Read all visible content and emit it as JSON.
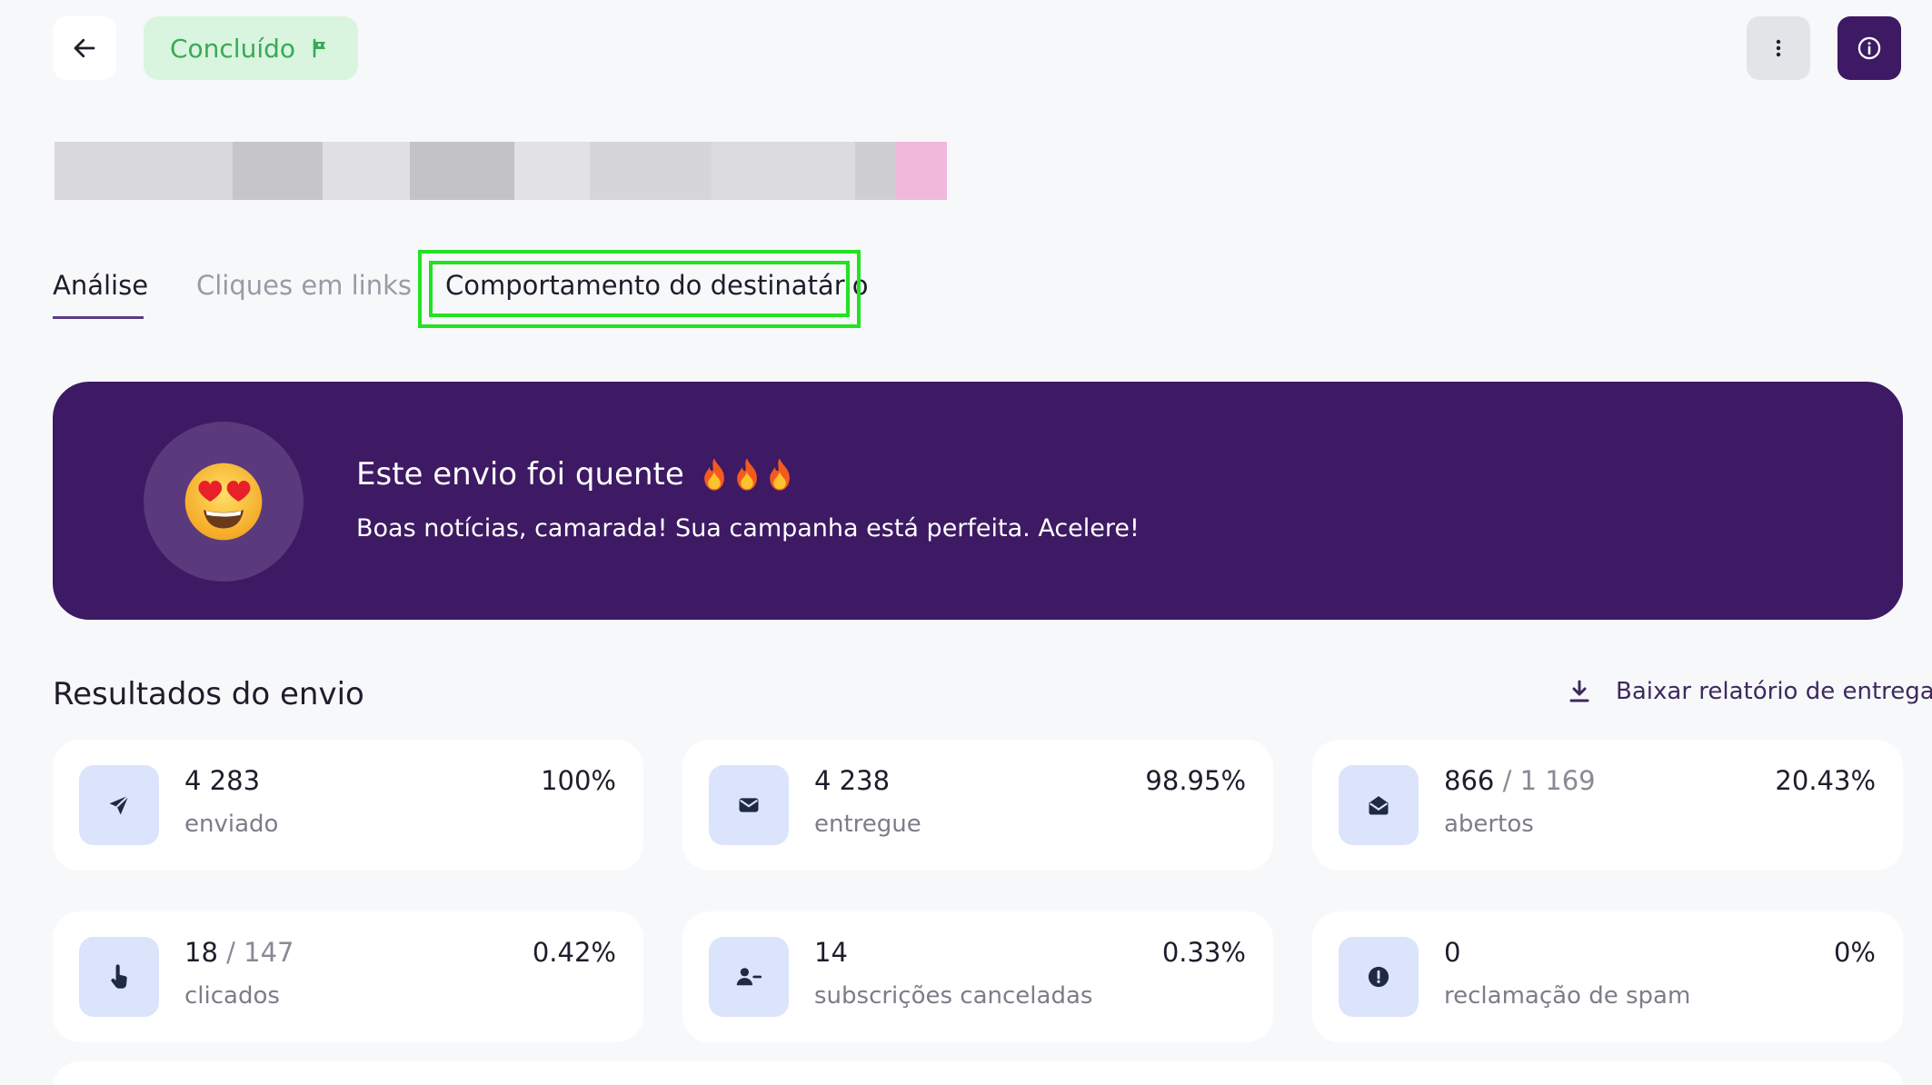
{
  "header": {
    "status_label": "Concluído",
    "icons": {
      "back": "arrow-left-icon",
      "status": "flag-icon",
      "more": "more-vertical-icon",
      "info": "info-icon"
    }
  },
  "colors": {
    "brand_purple": "#3d1a63",
    "status_green": "#3aa955",
    "status_green_bg": "#d9f5df",
    "highlight_green": "#22e222",
    "icon_bg": "#dbe4fb"
  },
  "tabs": [
    {
      "label": "Análise",
      "active": true
    },
    {
      "label": "Cliques em links",
      "active": false
    },
    {
      "label": "Comportamento do destinatário",
      "active": false,
      "highlighted": true
    }
  ],
  "banner": {
    "title": "Este envio foi quente",
    "title_icons": [
      "fire-icon",
      "fire-icon",
      "fire-icon"
    ],
    "subtitle": "Boas notícias, camarada! Sua campanha está perfeita. Acelere!",
    "emoji": "heart-eyes-emoji-icon"
  },
  "results": {
    "title": "Resultados do envio",
    "download_label": "Baixar relatório de entrega",
    "download_icon": "download-icon",
    "stats": [
      {
        "value": "4 283",
        "total": "",
        "label": "enviado",
        "percent": "100%",
        "icon": "send-icon"
      },
      {
        "value": "4 238",
        "total": "",
        "label": "entregue",
        "percent": "98.95%",
        "icon": "envelope-icon"
      },
      {
        "value": "866",
        "total": "1 169",
        "label": "abertos",
        "percent": "20.43%",
        "icon": "envelope-open-icon"
      },
      {
        "value": "18",
        "total": "147",
        "label": "clicados",
        "percent": "0.42%",
        "icon": "pointer-hand-icon"
      },
      {
        "value": "14",
        "total": "",
        "label": "subscrições canceladas",
        "percent": "0.33%",
        "icon": "user-minus-icon"
      },
      {
        "value": "0",
        "total": "",
        "label": "reclamação de spam",
        "percent": "0%",
        "icon": "alert-circle-icon"
      }
    ]
  }
}
